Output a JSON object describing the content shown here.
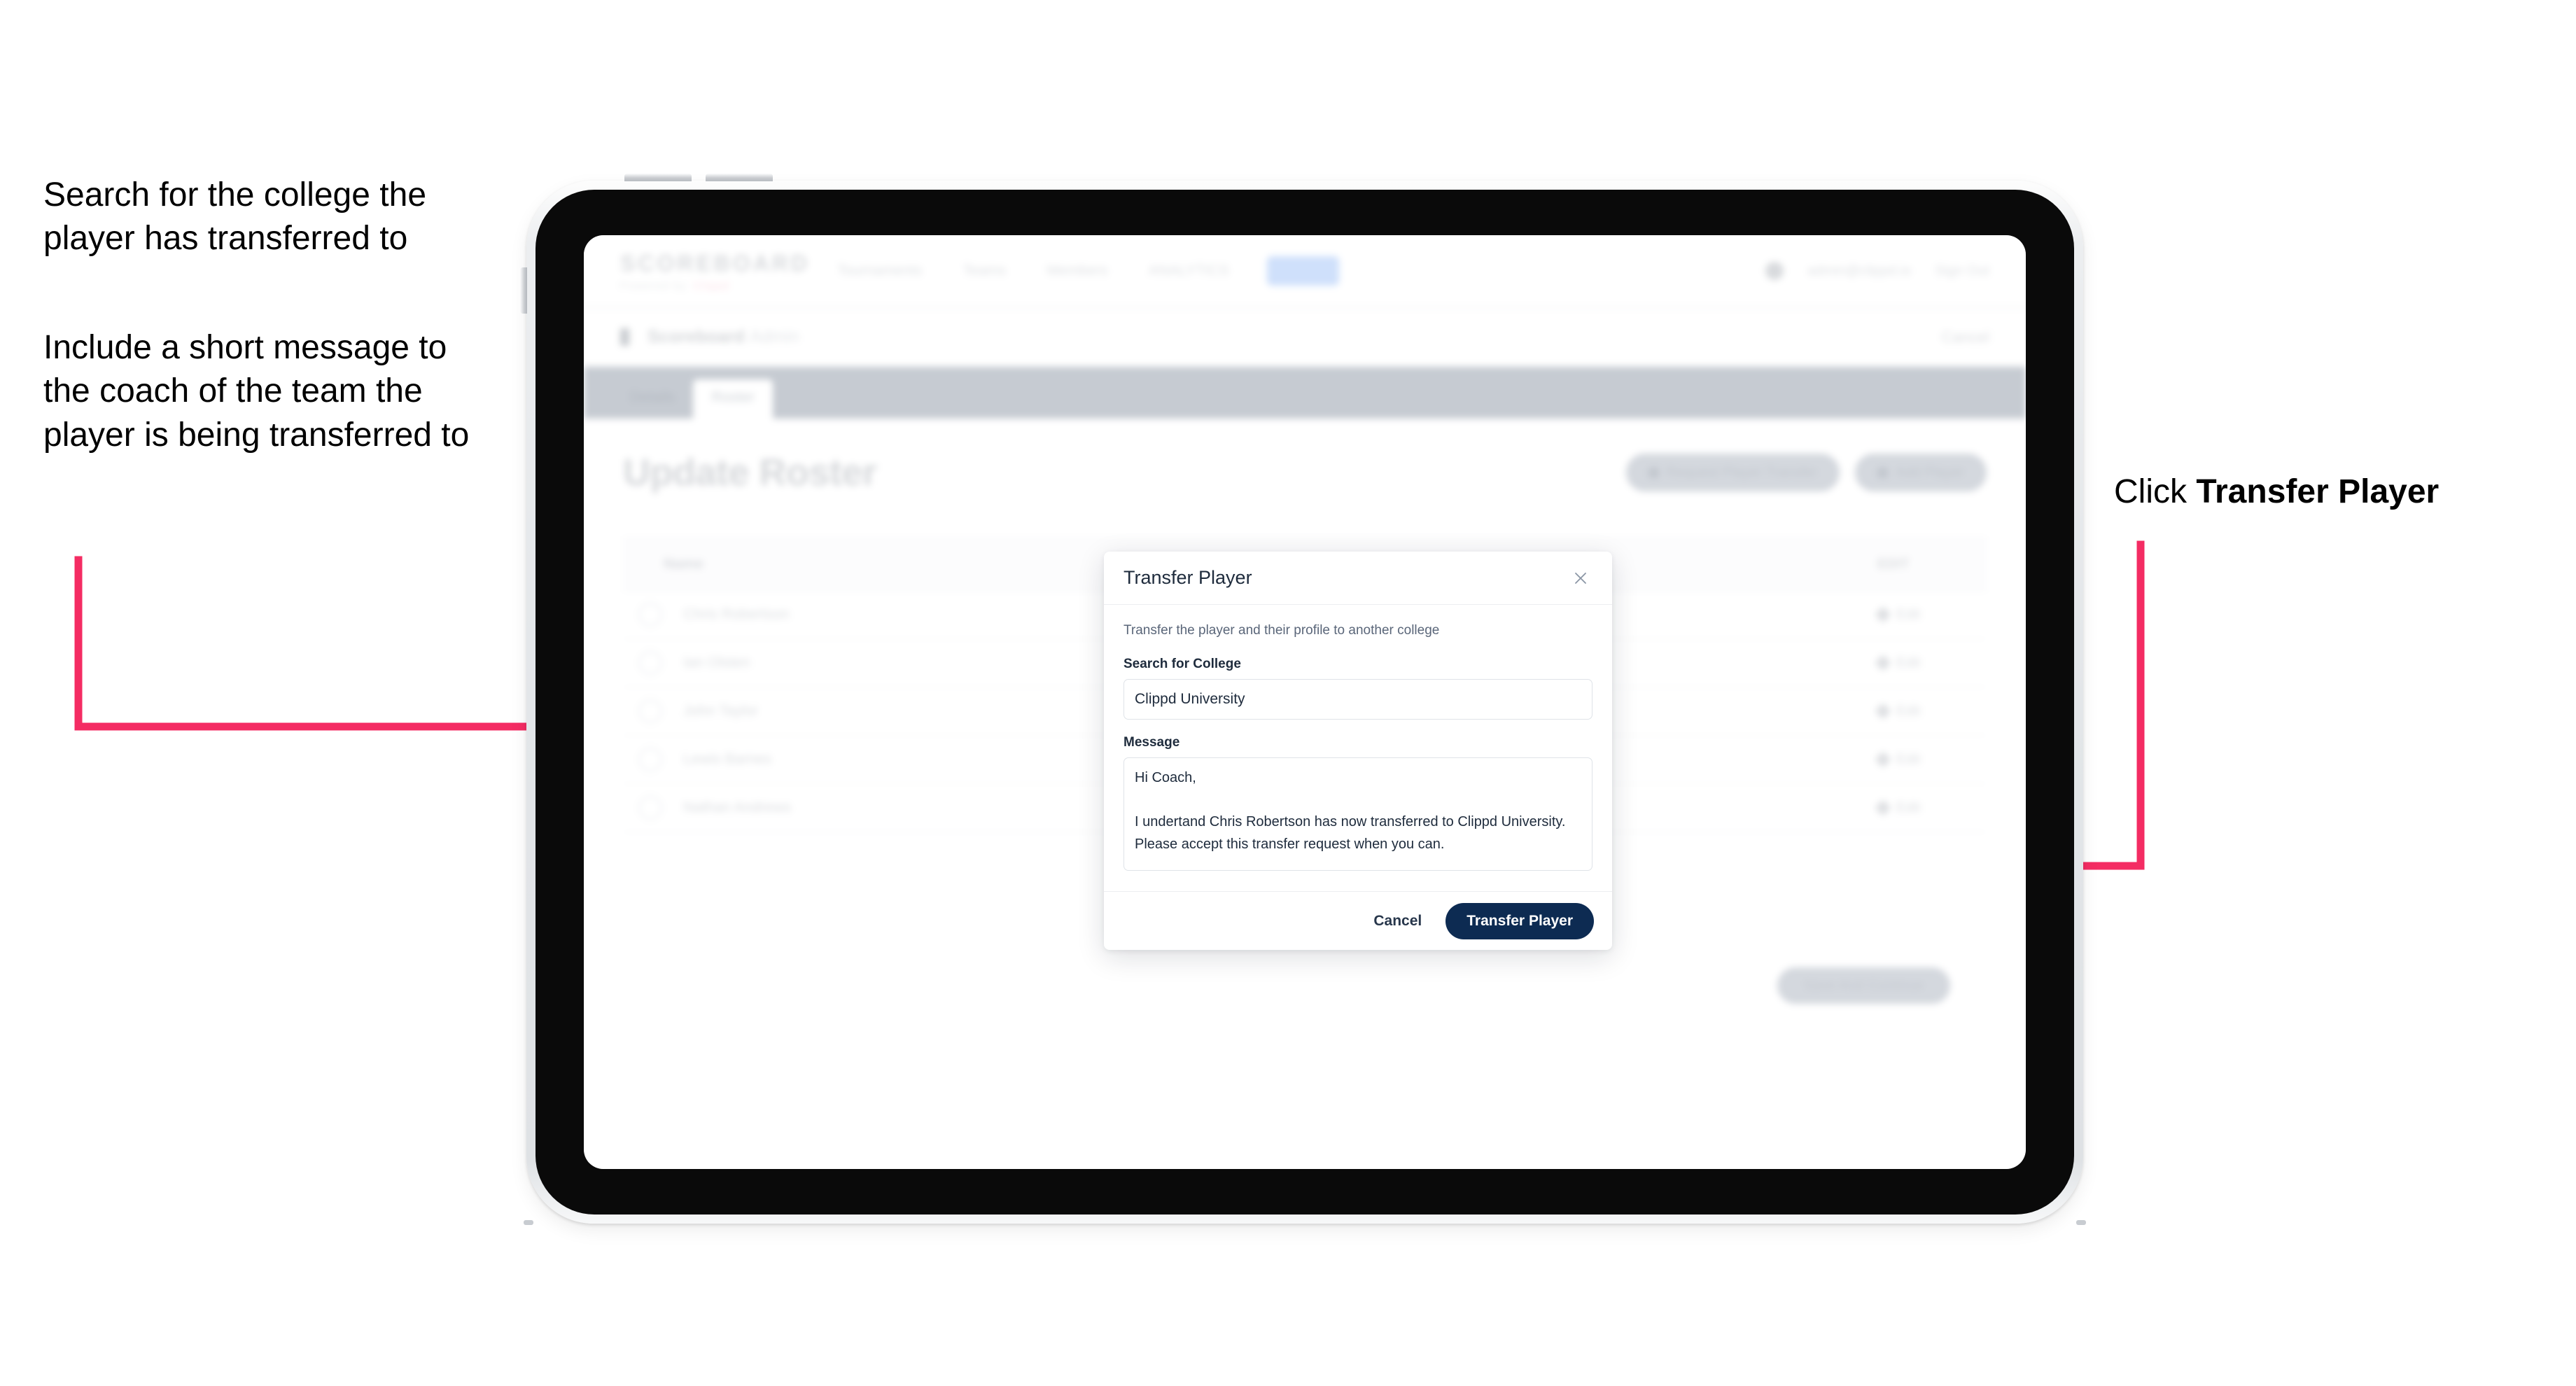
{
  "annotations": {
    "left_top": "Search for the college the player has transferred to",
    "left_bottom": "Include a short message to the coach of the team the player is being transferred to",
    "right_prefix": "Click ",
    "right_bold": "Transfer Player"
  },
  "app": {
    "brand": {
      "name": "SCOREBOARD",
      "tagline": "Powered by",
      "tagline_accent": "Clippd"
    },
    "nav": [
      {
        "label": "Tournaments",
        "active": false
      },
      {
        "label": "Teams",
        "active": false
      },
      {
        "label": "Members",
        "active": false
      },
      {
        "label": "ANALYTICS",
        "active": false
      },
      {
        "label": "Admin",
        "active": true
      }
    ],
    "nav_right": {
      "user": "admin@clippd.io",
      "signout": "Sign Out"
    },
    "subbar": {
      "icon": "trophy-icon",
      "title": "Scoreboard",
      "subtitle": "Admin",
      "right_action": "Cancel"
    },
    "tabs": [
      {
        "label": "Details",
        "active": false
      },
      {
        "label": "Roster",
        "active": true
      }
    ],
    "page_title": "Update Roster",
    "header_buttons": [
      {
        "label": "Request Player Transfer",
        "icon": "transfer-icon"
      },
      {
        "label": "Add Player",
        "icon": "plus-icon"
      }
    ],
    "roster": {
      "columns": [
        "Name",
        "EDIT"
      ],
      "rows": [
        {
          "name": "Chris Robertson",
          "edit": "Edit"
        },
        {
          "name": "Ian Olsten",
          "edit": "Edit"
        },
        {
          "name": "John Taylor",
          "edit": "Edit"
        },
        {
          "name": "Lewis Barnes",
          "edit": "Edit"
        },
        {
          "name": "Nathan Andrews",
          "edit": "Edit"
        }
      ]
    },
    "footer_button": "Save And Continue"
  },
  "modal": {
    "title": "Transfer Player",
    "close_icon": "close-icon",
    "description": "Transfer the player and their profile to another college",
    "college": {
      "label": "Search for College",
      "value": "Clippd University",
      "placeholder": "Search for College"
    },
    "message": {
      "label": "Message",
      "value": "Hi Coach,\n\nI undertand Chris Robertson has now transferred to Clippd University. Please accept this transfer request when you can.",
      "placeholder": "Message"
    },
    "cancel_label": "Cancel",
    "submit_label": "Transfer Player"
  },
  "colors": {
    "annotation_arrow": "#F42C63",
    "primary_button": "#0D2B52",
    "modal_text": "#1E2B3C",
    "device_bezel": "#0A0A0A",
    "device_shell": "#E3E6E9"
  }
}
